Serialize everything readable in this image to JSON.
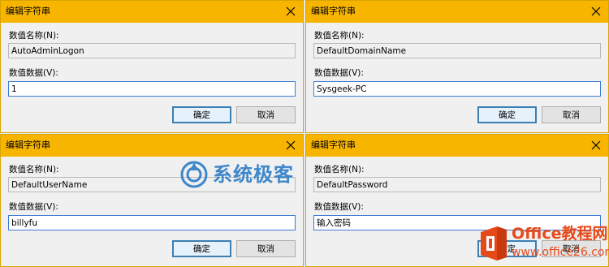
{
  "dialogs": [
    {
      "title": "编辑字符串",
      "value_name_label": "数值名称(N):",
      "value_name": "AutoAdminLogon",
      "value_data_label": "数值数据(V):",
      "value_data": "1",
      "ok_label": "确定",
      "cancel_label": "取消"
    },
    {
      "title": "编辑字符串",
      "value_name_label": "数值名称(N):",
      "value_name": "DefaultDomainName",
      "value_data_label": "数值数据(V):",
      "value_data": "Sysgeek-PC",
      "ok_label": "确定",
      "cancel_label": "取消"
    },
    {
      "title": "编辑字符串",
      "value_name_label": "数值名称(N):",
      "value_name": "DefaultUserName",
      "value_data_label": "数值数据(V):",
      "value_data": "billyfu",
      "ok_label": "确定",
      "cancel_label": "取消"
    },
    {
      "title": "编辑字符串",
      "value_name_label": "数值名称(N):",
      "value_name": "DefaultPassword",
      "value_data_label": "数值数据(V):",
      "value_data": "输入密码",
      "ok_label": "确定",
      "cancel_label": "取消"
    }
  ],
  "watermark": {
    "text": "系统极客",
    "icon": "sysgeek-logo-icon",
    "color": "#2f7fc8"
  },
  "office_badge": {
    "title": "Office教程网",
    "url": "www.office26.com",
    "icon": "office-logo-icon",
    "color": "#e74a1a"
  },
  "colors": {
    "titlebar": "#f7b500",
    "focus_border": "#3d7bd6",
    "dialog_bg": "#f0f0f0"
  }
}
